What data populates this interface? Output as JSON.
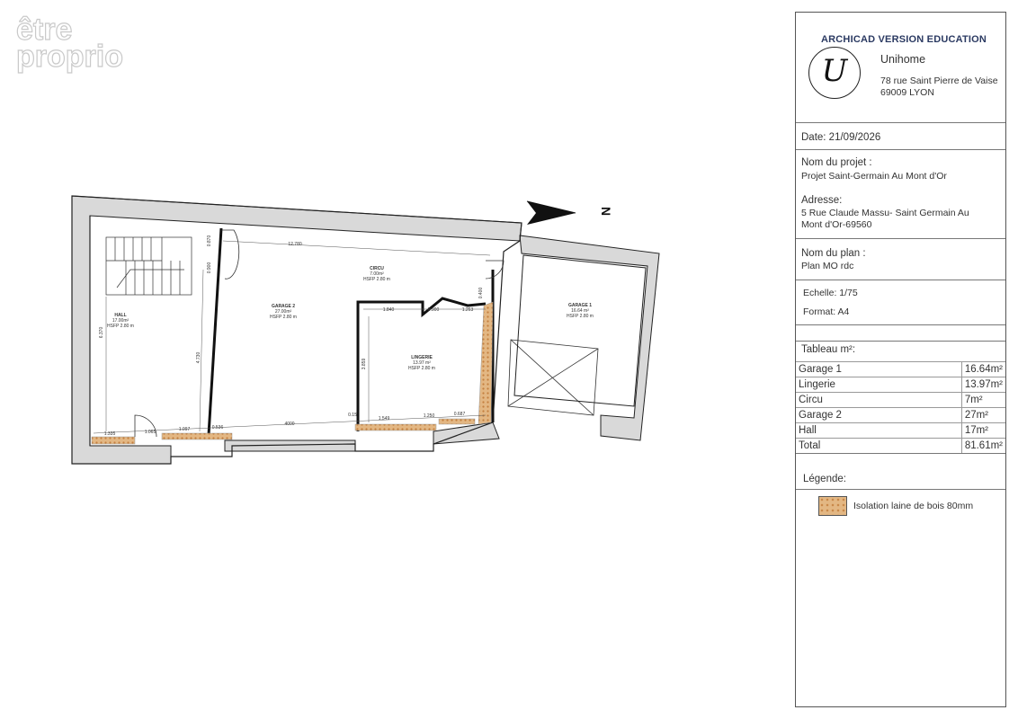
{
  "watermark": {
    "line1": "être",
    "line2": "proprio"
  },
  "north_label": "N",
  "rooms": [
    {
      "name": "HALL",
      "area": "17.00m²",
      "height": "HSFP 2.80 m"
    },
    {
      "name": "GARAGE 2",
      "area": "27.00m²",
      "height": "HSFP 2.80 m"
    },
    {
      "name": "CIRCU",
      "area": "7.00m²",
      "height": "HSFP 2.80 m"
    },
    {
      "name": "LINGERIE",
      "area": "13.97 m²",
      "height": "HSFP 2.80 m"
    },
    {
      "name": "GARAGE 1",
      "area": "16.64 m²",
      "height": "HSFP 2.80 m"
    }
  ],
  "dimensions": {
    "top_length": "12.780",
    "hall_depth": "6.370",
    "garage2_depth": "4.730",
    "lingerie_depth": "3.859",
    "stair_a": "0.870",
    "stair_b": "0.900",
    "lingerie_w1": "1.840",
    "lingerie_w2": "0.900",
    "lingerie_w3": "1.263",
    "circu_gap": "0.400",
    "bottom_1": "1.335",
    "bottom_2": "1.065",
    "bottom_3": "1.097",
    "bottom_4": "0.536",
    "bottom_5": "4000",
    "bottom_6": "0.15",
    "bottom_7": "1.549",
    "bottom_8": "1.250",
    "bottom_9": "0.687"
  },
  "panel": {
    "header": "ARCHICAD VERSION EDUCATION",
    "logo_letter": "U",
    "company": "Unihome",
    "address1": "78 rue Saint Pierre de Vaise",
    "address2": "69009 LYON",
    "date": "Date: 21/09/2026",
    "project_label": "Nom du projet :",
    "project_value": "Projet Saint-Germain Au Mont d'Or",
    "address_label": "Adresse:",
    "address_value1": "5 Rue Claude Massu- Saint Germain Au",
    "address_value2": "Mont d'Or-69560",
    "plan_label": "Nom du plan :",
    "plan_value": "Plan MO rdc",
    "scale": "Echelle: 1/75",
    "format": "Format: A4",
    "table_title": "Tableau m²:",
    "table": [
      {
        "room": "Garage 1",
        "value": "16.64m²"
      },
      {
        "room": "Lingerie",
        "value": "13.97m²"
      },
      {
        "room": "Circu",
        "value": "7m²"
      },
      {
        "room": "Garage 2",
        "value": "27m²"
      },
      {
        "room": "Hall",
        "value": "17m²"
      }
    ],
    "total_label": "Total",
    "total_value": "81.61m²",
    "legend_title": "Légende:",
    "legend_item": "Isolation laine de bois 80mm"
  },
  "colors": {
    "insulation": "#e3b783",
    "wall": "#222222",
    "header_text": "#2b3a62"
  }
}
